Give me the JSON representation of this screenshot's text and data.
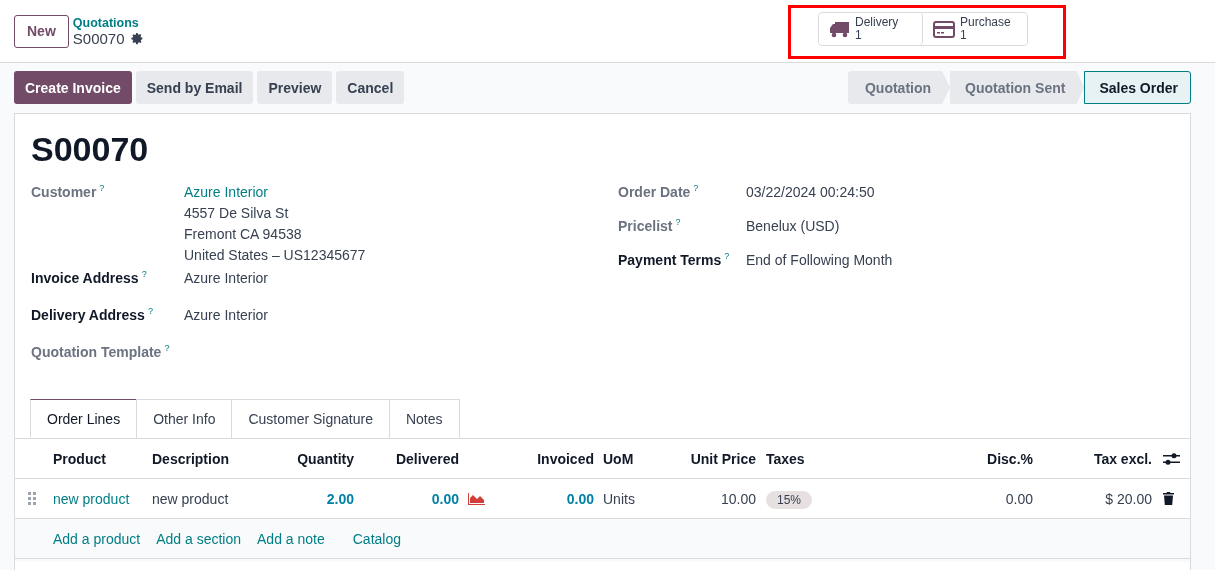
{
  "control_panel": {
    "new_button": "New",
    "breadcrumb": "Quotations",
    "record_name": "S00070"
  },
  "smart_buttons": [
    {
      "kind": "truck",
      "label": "Delivery",
      "count": "1"
    },
    {
      "kind": "card",
      "label": "Purchase",
      "count": "1"
    }
  ],
  "highlight": {
    "on": true
  },
  "actions": [
    {
      "label": "Create Invoice",
      "primary": true
    },
    {
      "label": "Send by Email",
      "primary": false
    },
    {
      "label": "Preview",
      "primary": false
    },
    {
      "label": "Cancel",
      "primary": false
    }
  ],
  "status_steps": [
    {
      "label": "Quotation",
      "selected": false
    },
    {
      "label": "Quotation Sent",
      "selected": false
    },
    {
      "label": "Sales Order",
      "selected": true
    }
  ],
  "title": "S00070",
  "left_fields": [
    {
      "label": "Customer",
      "help": "?",
      "required": false,
      "value": "Azure Interior",
      "link": true,
      "lines": [
        "4557 De Silva St",
        "Fremont CA 94538",
        "United States – US12345677"
      ]
    },
    {
      "label": "Invoice Address",
      "help": "?",
      "required": true,
      "value": "Azure Interior",
      "link": false
    },
    {
      "label": "Delivery Address",
      "help": "?",
      "required": true,
      "value": "Azure Interior",
      "link": false
    },
    {
      "label": "Quotation Template",
      "help": "?",
      "required": false
    }
  ],
  "right_fields": [
    {
      "label": "Order Date",
      "help": "?",
      "required": false,
      "value": "03/22/2024 00:24:50"
    },
    {
      "label": "Pricelist",
      "help": "?",
      "required": false,
      "value": "Benelux (USD)"
    },
    {
      "label": "Payment Terms",
      "help": "?",
      "required": true,
      "value": "End of Following Month"
    }
  ],
  "tabs": [
    {
      "label": "Order Lines",
      "selected": true
    },
    {
      "label": "Other Info",
      "selected": false
    },
    {
      "label": "Customer Signature",
      "selected": false
    },
    {
      "label": "Notes",
      "selected": false
    }
  ],
  "table": {
    "columns": [
      "Product",
      "Description",
      "Quantity",
      "Delivered",
      "Invoiced",
      "UoM",
      "Unit Price",
      "Taxes",
      "Disc.%",
      "Tax excl."
    ],
    "rows": [
      {
        "product": "new product",
        "description": "new product",
        "quantity": "2.00",
        "delivered": "0.00",
        "invoiced": "0.00",
        "uom": "Units",
        "unit_price": "10.00",
        "taxes": [
          "15%"
        ],
        "discount": "0.00",
        "subtotal": "$ 20.00"
      }
    ],
    "add_links": [
      "Add a product",
      "Add a section",
      "Add a note",
      "Catalog"
    ]
  }
}
